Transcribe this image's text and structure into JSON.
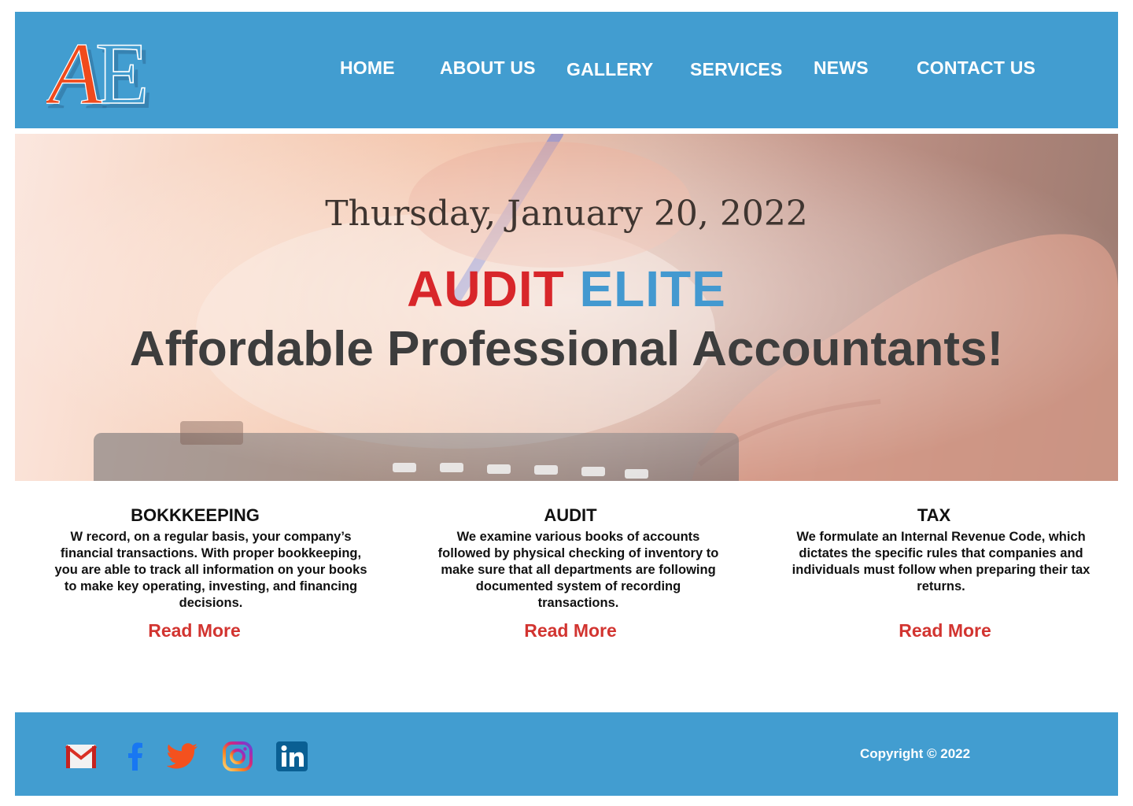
{
  "colors": {
    "bar_blue": "#429dd0",
    "brand_red": "#d8262a",
    "brand_blue": "#4399d0",
    "link_red": "#d23430"
  },
  "logo": {
    "letters": "AE",
    "icon": "ae-monogram-logo"
  },
  "nav": {
    "items": [
      {
        "label": "HOME"
      },
      {
        "label": "ABOUT US"
      },
      {
        "label": "GALLERY"
      },
      {
        "label": "SERVICES"
      },
      {
        "label": "NEWS"
      },
      {
        "label": "CONTACT US"
      }
    ]
  },
  "hero": {
    "date": "Thursday, January 20, 2022",
    "brand_part1": "AUDIT",
    "brand_part2": "ELITE",
    "tagline": "Affordable Professional Accountants!"
  },
  "services": [
    {
      "title": "BOKKKEEPING",
      "description": "W record, on a regular basis, your company’s financial transactions. With proper bookkeeping, you are able to track all information on your books to make key operating, investing, and financing decisions.",
      "link": "Read More"
    },
    {
      "title": "AUDIT",
      "description": "We examine  various books of accounts followed by physical checking of inventory to make sure that all departments are following documented system of recording transactions.",
      "link": "Read More"
    },
    {
      "title": "TAX",
      "description": "We formulate an Internal Revenue Code, which dictates the specific rules that companies and individuals must follow when preparing their tax returns.",
      "link": "Read More"
    }
  ],
  "footer": {
    "social_icons": [
      "gmail-icon",
      "facebook-icon",
      "twitter-icon",
      "instagram-icon",
      "linkedin-icon"
    ],
    "copyright": "Copyright © 2022"
  }
}
